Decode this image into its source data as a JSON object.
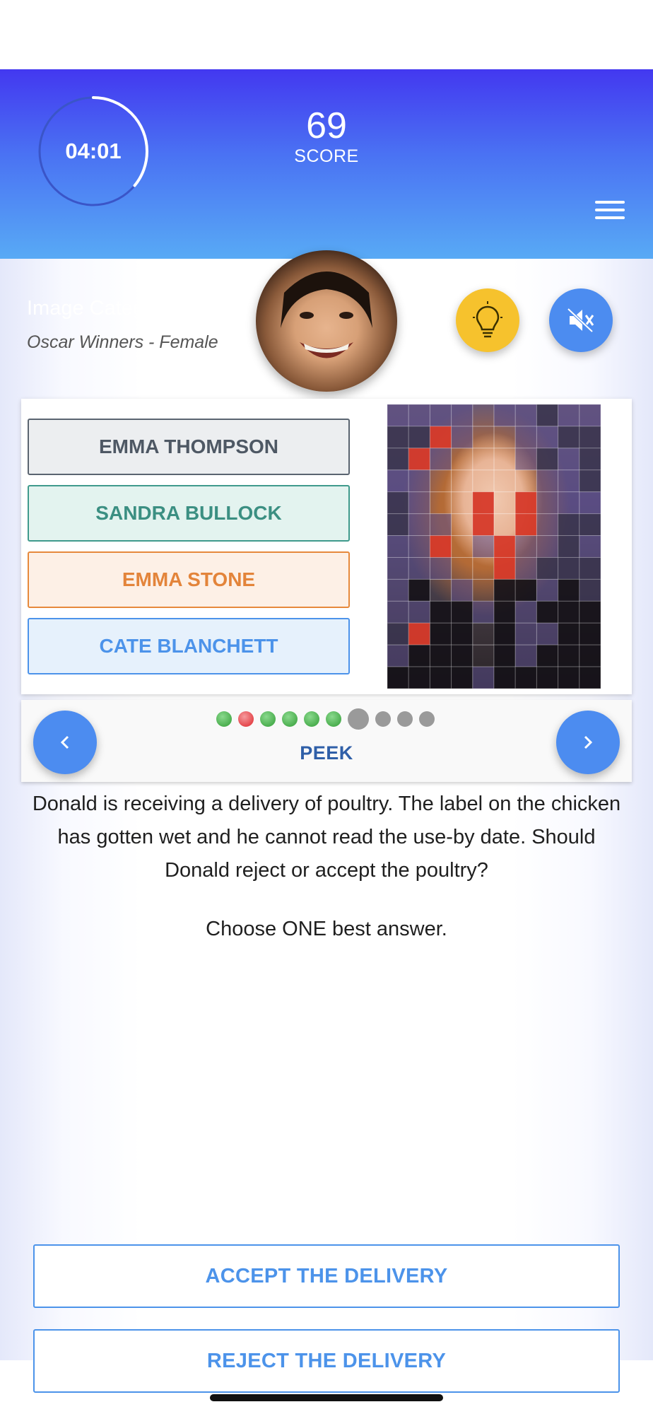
{
  "header": {
    "timer": "04:01",
    "timer_progress": 0.36,
    "score_value": "69",
    "score_label": "SCORE"
  },
  "category": {
    "label": "Image Category",
    "value": "Oscar Winners - Female"
  },
  "icons": {
    "menu": "hamburger-menu-icon",
    "hint": "lightbulb-icon",
    "sound": "speaker-muted-icon",
    "prev": "chevron-left-icon",
    "next": "chevron-right-icon"
  },
  "options": [
    {
      "label": "EMMA THOMPSON"
    },
    {
      "label": "SANDRA BULLOCK"
    },
    {
      "label": "EMMA STONE"
    },
    {
      "label": "CATE BLANCHETT"
    }
  ],
  "progress_dots": [
    "correct",
    "wrong",
    "correct",
    "correct",
    "correct",
    "correct",
    "current",
    "pending",
    "pending",
    "pending"
  ],
  "peek_label": "PEEK",
  "question": "Donald is receiving a delivery of poultry. The label on the chicken has gotten wet and he cannot read the use-by date. Should Donald reject or accept the poultry?",
  "instruction": "Choose ONE best answer.",
  "answers": [
    {
      "label": "ACCEPT THE DELIVERY"
    },
    {
      "label": "REJECT THE DELIVERY"
    }
  ],
  "colors": {
    "header_top": "#4338f0",
    "header_bottom": "#58aaf5",
    "accent_blue": "#4c93ea",
    "hint_yellow": "#f6c22d",
    "dot_correct": "#4caf50",
    "dot_wrong": "#e5484d",
    "dot_pending": "#9a9a9a"
  }
}
